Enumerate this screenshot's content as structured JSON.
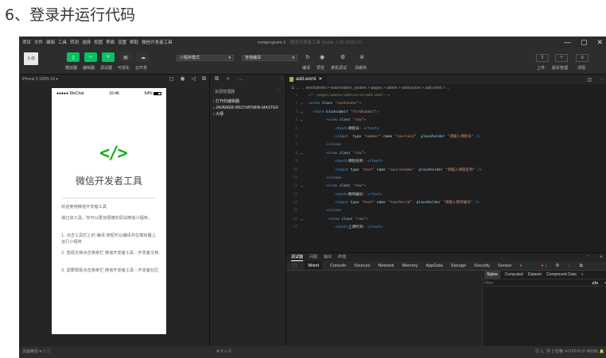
{
  "heading": "6、登录并运行代码",
  "menu": [
    "项目",
    "文件",
    "编辑",
    "工具",
    "转到",
    "选择",
    "视图",
    "界面",
    "设置",
    "帮助",
    "微信开发者工具"
  ],
  "window_title": "miniprogram-1",
  "window_subtitle": " - 微信开发者工具 Stable 1.05.2105170",
  "window_controls": [
    "—",
    "▢",
    "✕"
  ],
  "toolbar": {
    "avatar_text": "头像",
    "buttons": [
      "模拟器",
      "编辑器",
      "调试器",
      "可视化",
      "云开发"
    ],
    "mode_select": "小程序模式",
    "compile_select": "普通编译",
    "compile_actions": [
      "编译",
      "预览",
      "真机调试",
      "清缓存"
    ],
    "right_buttons": [
      "上传",
      "版本管理",
      "详情"
    ]
  },
  "simulator": {
    "device_label": "iPhone 5 100% 16 ▾",
    "status_left": "●●●●● WeChat",
    "status_time": "16:46",
    "status_battery": "64%",
    "logo": "</>",
    "app_title": "微信开发者工具",
    "paragraphs": [
      "欢迎使用微信开发者工具",
      "通过该工具，你可以更加便捷的调试微信小程序。",
      "1. 点击工具栏上的 编译 按钮可以编译并在模拟器上运行小程序",
      "2. 查阅文档点击菜单栏 微信开发者工具 - 开发者文档",
      "3. 需要帮助点击菜单栏 微信开发者工具 - 开发者社区"
    ]
  },
  "explorer": {
    "title": "资源管理器",
    "items": [
      "› 打开的编辑器",
      "› JAVAWEB-WECHATMINI-MASTER",
      "› 大纲"
    ]
  },
  "editor": {
    "tab_name": "add.wxml",
    "breadcrumb": "wechatmini > examination_system > pages > admin > addcourse > add.wxml > ...",
    "lines": [
      {
        "n": "1",
        "f": "",
        "html": "<span class='cm'>&lt;!--pages/admin/addcourse/add.wxml--&gt;</span>"
      },
      {
        "n": "2",
        "f": "⌄",
        "html": "<span class='tg'>&lt;view</span> <span class='at'>class</span>=<span class='st'>\"container\"</span><span class='tg'>&gt;</span>"
      },
      {
        "n": "3",
        "f": "⌄",
        "html": "  <span class='tg'>&lt;form</span> <span class='at'>bindsubmit</span>=<span class='st'>\"formSubmit\"</span><span class='tg'>&gt;</span>"
      },
      {
        "n": "4",
        "f": "⌄",
        "html": "        <span class='tg'>&lt;view</span> <span class='at'>class</span>=<span class='st'>\"row\"</span><span class='tg'>&gt;</span>"
      },
      {
        "n": "5",
        "f": "",
        "html": "            <span class='tg'>&lt;text&gt;</span><span class='tx'>课程号: </span><span class='tg'>&lt;/text&gt;</span>"
      },
      {
        "n": "6",
        "f": "",
        "html": "            <span class='tg'>&lt;input</span>  <span class='at'>type</span>=<span class='st'>\"number\"</span> <span class='at'>name</span>=<span class='st'>\"courseid\"</span>  <span class='at'>placeholder</span>=<span class='st'>\"请输入课程号\"</span> <span class='tg'>/&gt;</span>"
      },
      {
        "n": "7",
        "f": "",
        "html": "        <span class='tg'>&lt;/view&gt;</span>"
      },
      {
        "n": "8",
        "f": "⌄",
        "html": "        <span class='tg'>&lt;view</span> <span class='at'>class</span>=<span class='st'>\"row\"</span><span class='tg'>&gt;</span>"
      },
      {
        "n": "9",
        "f": "",
        "html": "            <span class='tg'>&lt;text&gt;</span><span class='tx'>课程名称: </span><span class='tg'>&lt;/text&gt;</span>"
      },
      {
        "n": "10",
        "f": "",
        "html": "            <span class='tg'>&lt;input</span> <span class='at'>type</span>=<span class='st'>\"text\"</span> <span class='at'>name</span>=<span class='st'>\"coursename\"</span>  <span class='at'>placeholder</span>=<span class='st'>\"请输入课程名称\"</span> <span class='tg'>/&gt;</span>"
      },
      {
        "n": "11",
        "f": "",
        "html": "        <span class='tg'>&lt;/view&gt;</span>"
      },
      {
        "n": "12",
        "f": "⌄",
        "html": "        <span class='tg'>&lt;view</span> <span class='at'>class</span>=<span class='st'>\"row\"</span><span class='tg'>&gt;</span>"
      },
      {
        "n": "13",
        "f": "",
        "html": "            <span class='tg'>&lt;text&gt;</span><span class='tx'>教师编号: </span><span class='tg'>&lt;/text&gt;</span>"
      },
      {
        "n": "14",
        "f": "",
        "html": "            <span class='tg'>&lt;input</span> <span class='at'>type</span>=<span class='st'>\"text\"</span> <span class='at'>name</span>=<span class='st'>\"teacherid\"</span>  <span class='at'>placeholder</span>=<span class='st'>\"请输入教师编号\"</span> <span class='tg'>/&gt;</span>"
      },
      {
        "n": "15",
        "f": "",
        "html": "        <span class='tg'>&lt;/view&gt;</span>"
      },
      {
        "n": "16",
        "f": "⌄",
        "html": "         <span class='tg'>&lt;view</span> <span class='at'>class</span>=<span class='st'>\"row\"</span><span class='tg'>&gt;</span>"
      },
      {
        "n": "17",
        "f": "",
        "html": "            <span class='tg'>&lt;text&gt;</span><span class='tx'>上课时间: </span><span class='tg'>&lt;/text&gt;</span>"
      }
    ]
  },
  "devtools": {
    "top_tabs": [
      "调试器",
      "问题",
      "输出",
      "终端"
    ],
    "tabs": [
      "Wxml",
      "Console",
      "Sources",
      "Network",
      "Memory",
      "AppData",
      "Storage",
      "Security",
      "Sensor",
      "»"
    ],
    "error_badge": "● 1",
    "styles_tabs": [
      "Styles",
      "Computed",
      "Dataset",
      "Component Data",
      "»"
    ],
    "filter_placeholder": "Filter",
    "cls_label": ".cls"
  },
  "statusbar": {
    "left": "页面路径 ▾  /  |  ⓘ",
    "mid": "⊗ 0 ⚠ 0",
    "right": "行 1，列 1   空格: 4   UTF-8   LF   WXML   🔔"
  }
}
